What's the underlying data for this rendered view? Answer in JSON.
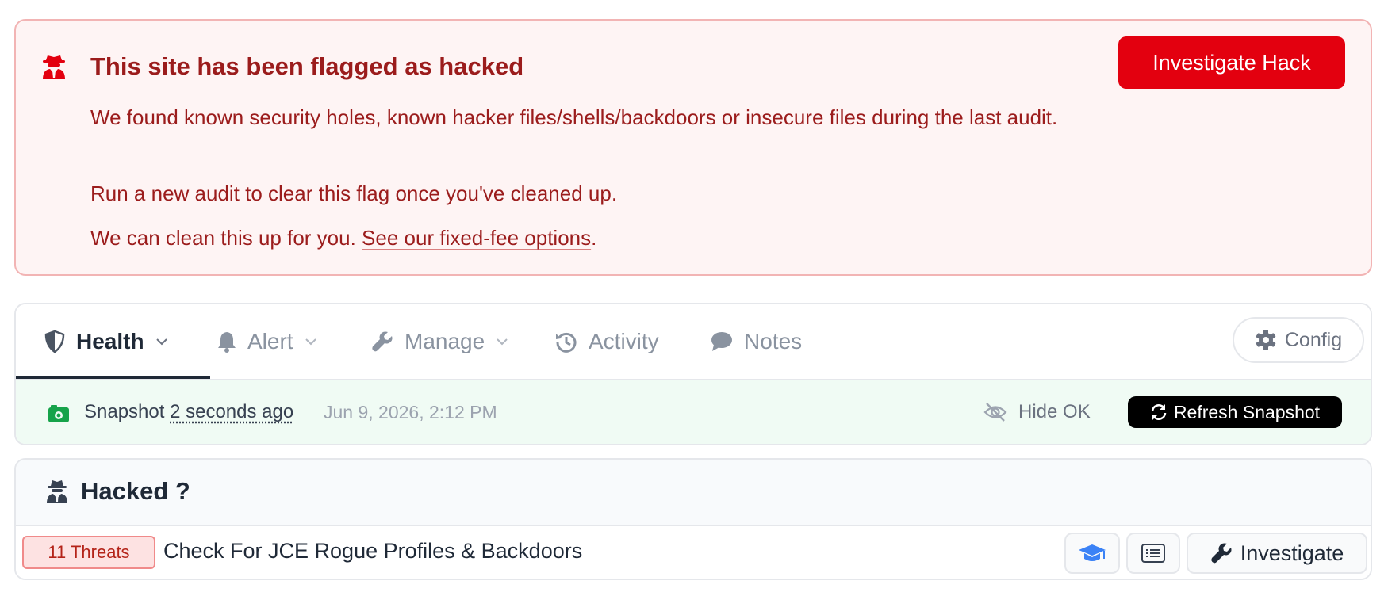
{
  "alert": {
    "title": "This site has been flagged as hacked",
    "message1": "We found known security holes, known hacker files/shells/backdoors or insecure files during the last audit.",
    "message2": "Run a new audit to clear this flag once you've cleaned up.",
    "message3_prefix": "We can clean this up for you. ",
    "message3_link": "See our fixed-fee options",
    "message3_suffix": ".",
    "button": "Investigate Hack",
    "colors": {
      "text": "#9b1c1c",
      "button": "#e3000f",
      "background": "#fef4f4"
    }
  },
  "tabs": [
    {
      "label": "Health",
      "icon": "shield-half-icon",
      "active": true
    },
    {
      "label": "Alert",
      "icon": "bell-icon",
      "active": false
    },
    {
      "label": "Manage",
      "icon": "wrench-icon",
      "active": false
    },
    {
      "label": "Activity",
      "icon": "history-icon",
      "active": false
    },
    {
      "label": "Notes",
      "icon": "comment-icon",
      "active": false
    }
  ],
  "config_button": "Config",
  "snapshot": {
    "label": "Snapshot",
    "ago": "2 seconds ago",
    "date": "Jun 9, 2026, 2:12 PM",
    "hide_ok": "Hide OK",
    "refresh": "Refresh Snapshot"
  },
  "hacked": {
    "title": "Hacked ?",
    "check": {
      "badge": "11 Threats",
      "label": "Check For JCE Rogue Profiles & Backdoors",
      "investigate": "Investigate"
    }
  }
}
